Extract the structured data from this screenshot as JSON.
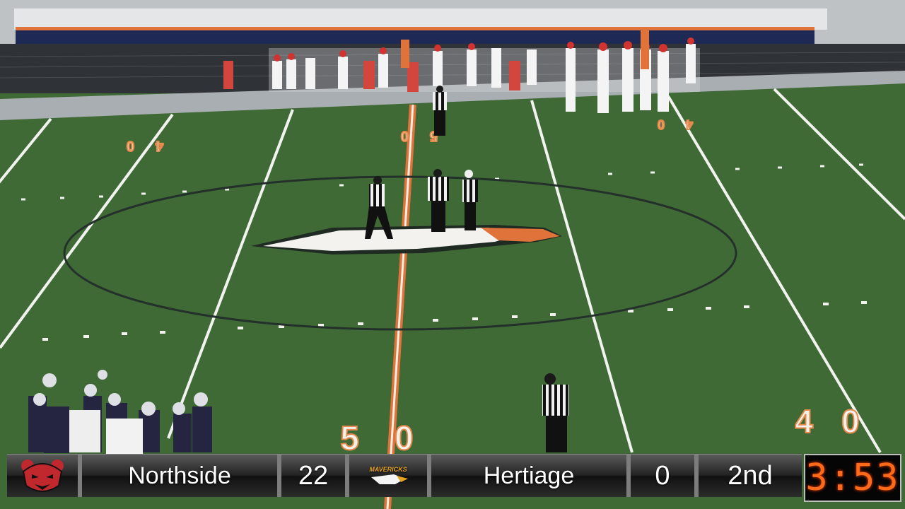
{
  "scoreboard": {
    "home_team": "Northside",
    "home_score": "22",
    "away_team": "Hertiage",
    "away_score": "0",
    "period": "2nd",
    "clock": "3:53",
    "away_logo_text": "MAVERICKS"
  },
  "field_markings": {
    "midfield_number": "50",
    "near_right_number": "40",
    "far_left_number": "40",
    "far_mid_number": "50",
    "far_right_number": "40"
  },
  "colors": {
    "turf": "#3f6a36",
    "orange_stripe": "#e0733a",
    "clock_digits": "#ff6a1a",
    "home_team_red": "#c0282d",
    "stadium_wall_blue": "#1e2a55"
  },
  "icons": {
    "home_logo": "bear-head-icon",
    "away_logo": "eagle-logo-icon",
    "midfield_logo": "eagle-head-icon"
  }
}
